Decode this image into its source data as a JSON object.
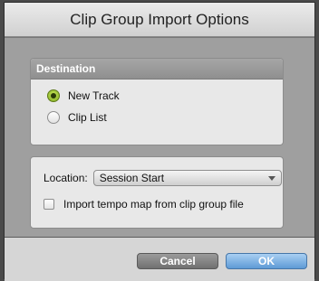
{
  "dialog": {
    "title": "Clip Group Import Options"
  },
  "destination": {
    "header": "Destination",
    "options": [
      {
        "label": "New Track",
        "selected": true
      },
      {
        "label": "Clip List",
        "selected": false
      }
    ]
  },
  "location": {
    "label": "Location:",
    "value": "Session Start"
  },
  "tempo": {
    "label": "Import tempo map from clip group file",
    "checked": false
  },
  "buttons": {
    "cancel": "Cancel",
    "ok": "OK"
  },
  "colors": {
    "ok_accent": "#5e9ad6",
    "radio_selected": "#8fb82a"
  }
}
